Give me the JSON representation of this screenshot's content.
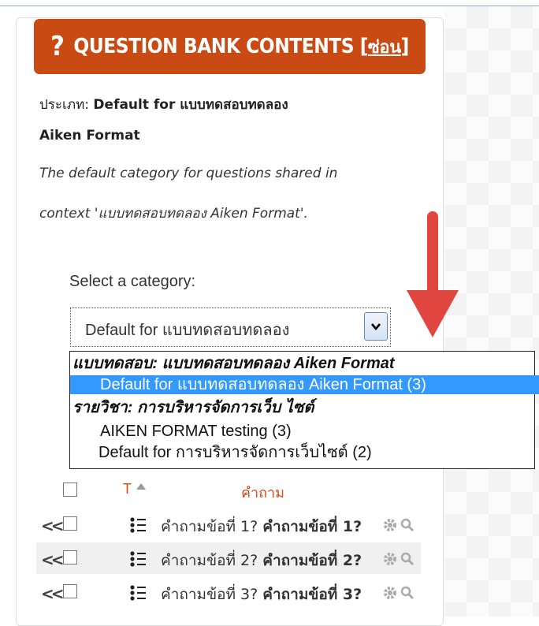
{
  "header": {
    "icon": "question-icon",
    "title": "QUESTION BANK CONTENTS [",
    "hide_link": "ซ่อน",
    "close": "]",
    "bg_color": "#c94a13"
  },
  "category_info": {
    "label": "ประเภท: ",
    "name_line1": "Default for แบบทดสอบทดลอง",
    "name_line2": "Aiken Format",
    "desc_line1": "The default category for questions shared in",
    "desc_line2": "context 'แบบทดสอบทดลอง Aiken Format'."
  },
  "select_category": {
    "label": "Select a category:",
    "current_value": "Default for แบบทดสอบทดลอง",
    "options": [
      {
        "text": "แบบทดสอบ: แบบทดสอบทดลอง Aiken Format",
        "group": true
      },
      {
        "text": "Default for แบบทดสอบทดลอง Aiken Format (3)",
        "selected": true
      },
      {
        "text": "รายวิชา: การบริหารจัดการเว็บ ไซต์",
        "group": true
      },
      {
        "text": "AIKEN FORMAT testing (3)"
      },
      {
        "text": "Default for การบริหารจัดการเว็บไซต์ (2)"
      }
    ]
  },
  "table": {
    "col_type": "T",
    "col_question": "คำถาม",
    "rows": [
      {
        "name": "คำถามข้อที่ 1?",
        "text": "คำถามข้อที่ 1?"
      },
      {
        "name": "คำถามข้อที่ 2?",
        "text": "คำถามข้อที่ 2?"
      },
      {
        "name": "คำถามข้อที่ 3?",
        "text": "คำถามข้อที่ 3?"
      }
    ]
  },
  "colors": {
    "accent_red": "#d84a1b",
    "arrow": "#e0463f",
    "selection": "#3399ff"
  }
}
